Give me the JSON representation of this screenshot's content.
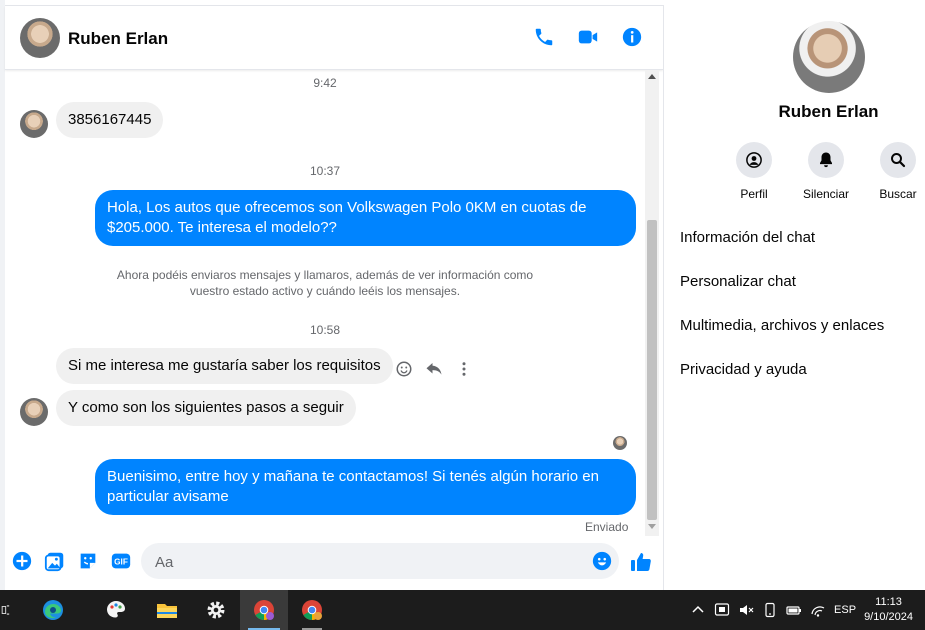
{
  "contact": {
    "name": "Ruben Erlan"
  },
  "header": {
    "call_icon": "phone-icon",
    "video_icon": "video-camera-icon",
    "info_icon": "info-icon",
    "accent_color": "#0084ff"
  },
  "messages": {
    "time1": "9:42",
    "msg1": "3856167445",
    "time2": "10:37",
    "msg2": "Hola, Los autos que ofrecemos son Volkswagen Polo 0KM en cuotas de $205.000. Te interesa el modelo??",
    "system_line1": "Ahora podéis enviaros mensajes y llamaros, además de ver información como",
    "system_line2": "vuestro estado activo y cuándo leéis los mensajes.",
    "time3": "10:58",
    "msg3": "Si me interesa me gustaría saber los requisitos",
    "msg4": "Y como son los siguientes pasos a seguir",
    "msg5": "Buenisimo, entre hoy y mañana te contactamos! Si tenés algún horario en particular avisame",
    "sent_status": "Enviado"
  },
  "composer": {
    "placeholder": "Aa",
    "icons": [
      "plus-icon",
      "image-icon",
      "sticker-icon",
      "gif-icon",
      "emoji-icon",
      "like-icon"
    ]
  },
  "info_panel": {
    "name": "Ruben Erlan",
    "actions": [
      {
        "label": "Perfil",
        "icon": "profile-icon"
      },
      {
        "label": "Silenciar",
        "icon": "bell-icon"
      },
      {
        "label": "Buscar",
        "icon": "search-icon"
      }
    ],
    "items": [
      "Información del chat",
      "Personalizar chat",
      "Multimedia, archivos y enlaces",
      "Privacidad y ayuda"
    ]
  },
  "taskbar": {
    "lang": "ESP",
    "time": "11:13",
    "date": "9/10/2024"
  }
}
